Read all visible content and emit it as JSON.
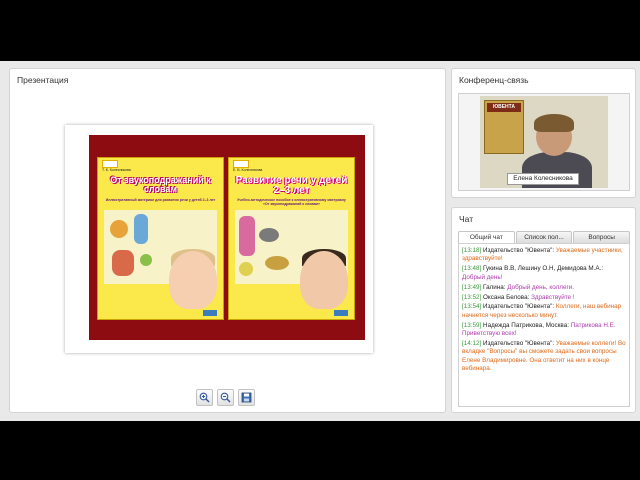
{
  "colors": {
    "chat_time": "#3a9a3a",
    "chat_text_orange": "#e06a1a",
    "chat_text_purple": "#b03ab0",
    "slide_bg": "#8d0c12"
  },
  "presentation": {
    "title": "Презентация",
    "slide": {
      "book1": {
        "author": "Т. Б. Колесникова",
        "title": "От звукоподражаний к словам",
        "subtitle": "Иллюстративный материал для развития речи у детей 2–3 лет"
      },
      "book2": {
        "author": "Е. В. Колесникова",
        "title": "Развитие речи у детей 2–3 лет",
        "subtitle": "Учебно-методическое пособие к иллюстративному материалу «От звукоподражаний к словам»"
      }
    },
    "tools": [
      {
        "name": "zoom-in-icon"
      },
      {
        "name": "zoom-out-icon"
      },
      {
        "name": "save-icon"
      }
    ]
  },
  "conference": {
    "title": "Конференц-связь",
    "video_book_label": "ЮВЕНТА",
    "speaker_name": "Елена Колесникова"
  },
  "chat": {
    "title": "Чат",
    "tabs": [
      "Общий чат",
      "Список пол...",
      "Вопросы"
    ],
    "messages": [
      {
        "time": "[13:18]",
        "author": "Издательство \"Ювента\":",
        "text": "Уважаемые участники, здравствуйте!",
        "style": "orange"
      },
      {
        "time": "[13:48]",
        "author": "Гукина В.В, Лешину О.Н, Демидова М.А.:",
        "text": "Добрый день!",
        "style": "purple"
      },
      {
        "time": "[13:49]",
        "author": "Галина:",
        "text": "Добрый день, коллеги.",
        "style": "purple"
      },
      {
        "time": "[13:52]",
        "author": "Оксана Белова:",
        "text": "Здравствуйте !",
        "style": "purple"
      },
      {
        "time": "[13:54]",
        "author": "Издательство \"Ювента\":",
        "text": "Коллеги, наш вебинар начнется через несколько минут.",
        "style": "orange"
      },
      {
        "time": "[13:59]",
        "author": "Надежда Патрикова, Москва:",
        "text": "Патрикова Н.Е. Приветствую всех!",
        "style": "purple"
      },
      {
        "time": "[14:12]",
        "author": "Издательство \"Ювента\":",
        "text": "Уважаемые коллеги! Во вкладке \"Вопросы\" вы сможете задать свои вопросы Елене Владимировне. Она ответит на них в конце вебинара.",
        "style": "orange"
      }
    ]
  }
}
